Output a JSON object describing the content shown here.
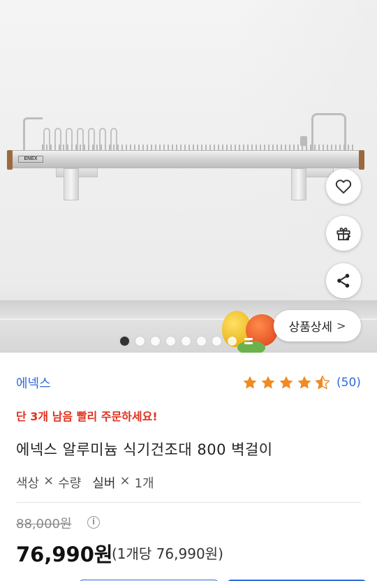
{
  "gallery": {
    "image": "wall-mounted aluminum dish drying rack",
    "rack_logo_text": "ENEX",
    "current_index": 1,
    "dot_count": 8,
    "detail_button_label": "상품상세",
    "detail_button_icon": "chevron-right-icon"
  },
  "actions": {
    "wishlist_icon": "heart-outline-icon",
    "gift_icon": "gift-icon",
    "share_icon": "share-icon"
  },
  "product": {
    "brand": "에넥스",
    "rating": 4.5,
    "review_count": "(50)",
    "urgency": "단 3개 남음 빨리 주문하세요!",
    "title": "에넥스 알루미늄 식기건조대 800 벽걸이",
    "option_label_color": "색상",
    "option_times_1": "×",
    "option_label_qty": "수량",
    "option_value_color": "실버",
    "option_times_2": "×",
    "option_value_qty": "1개",
    "original_price": "88,000원",
    "sale_price": "76,990원",
    "unit_price": "(1개당 76,990원)"
  },
  "colors": {
    "accent": "#2f6ad9",
    "urgency": "#e0301e",
    "star": "#f08a24"
  }
}
